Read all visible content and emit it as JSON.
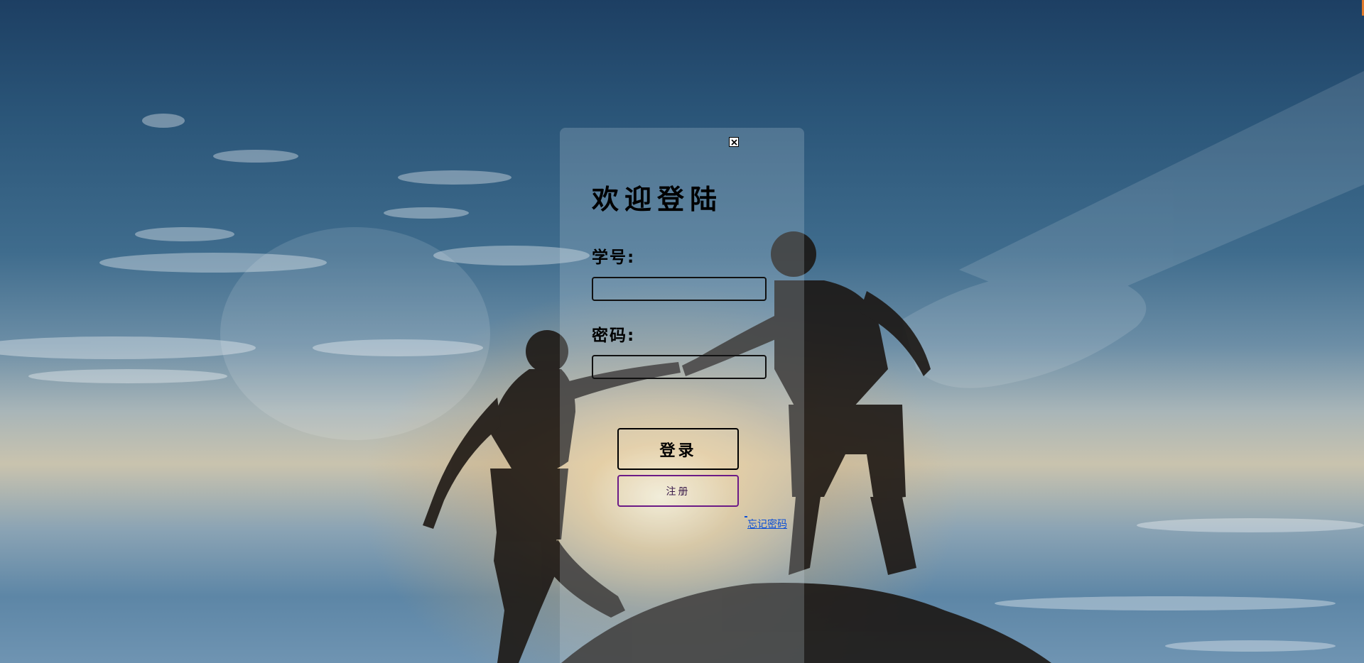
{
  "login": {
    "title": "欢迎登陆",
    "student_id_label": "学号:",
    "student_id_value": "",
    "password_label": "密码:",
    "password_value": "",
    "login_button": "登录",
    "register_button": "注册",
    "forgot_link": "忘记密码"
  },
  "icons": {
    "close": "close-icon"
  },
  "colors": {
    "register_border": "#6b1a86",
    "forgot_link": "#0b4fd6",
    "corner_accent": "#e07a2c"
  }
}
